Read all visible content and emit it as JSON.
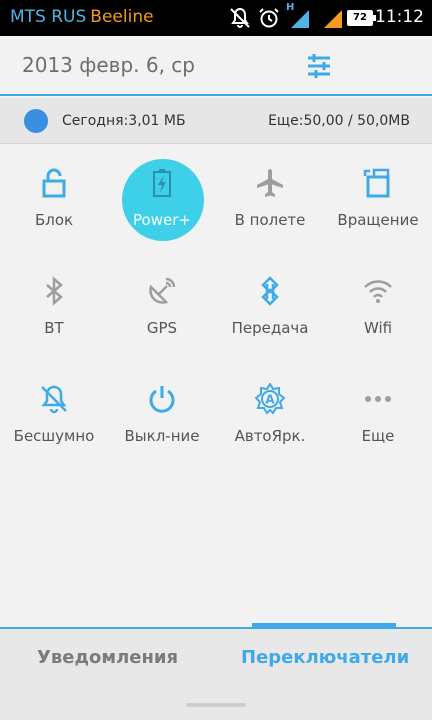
{
  "status_bar": {
    "carrier_primary": "MTS RUS",
    "carrier_secondary": "Beeline",
    "network_indicator": "H",
    "battery_level": "72",
    "time": "11:12",
    "icons": [
      "mute-icon",
      "alarm-icon",
      "signal-h-icon",
      "signal-icon",
      "battery-icon"
    ]
  },
  "header": {
    "date": "2013 февр. 6, ср",
    "settings_icon": "settings-sliders-icon"
  },
  "data_usage": {
    "today": "Сегодня:3,01 МБ",
    "remaining": "Еще:50,00 / 50,0MB"
  },
  "toggles": [
    {
      "label": "Блок",
      "icon": "lock-icon",
      "active": false
    },
    {
      "label": "Power+",
      "icon": "battery-saver-icon",
      "active": true
    },
    {
      "label": "В полете",
      "icon": "airplane-icon",
      "active": false
    },
    {
      "label": "Вращение",
      "icon": "rotation-icon",
      "active": false
    },
    {
      "label": "BT",
      "icon": "bluetooth-icon",
      "active": false
    },
    {
      "label": "GPS",
      "icon": "gps-icon",
      "active": false
    },
    {
      "label": "Передача",
      "icon": "data-transfer-icon",
      "active": false
    },
    {
      "label": "Wifi",
      "icon": "wifi-icon",
      "active": false
    },
    {
      "label": "Бесшумно",
      "icon": "silent-icon",
      "active": false
    },
    {
      "label": "Выкл-ние",
      "icon": "power-icon",
      "active": false
    },
    {
      "label": "АвтоЯрк.",
      "icon": "auto-brightness-icon",
      "active": false
    },
    {
      "label": "Еще",
      "icon": "more-icon",
      "active": false
    }
  ],
  "tabs": {
    "notifications": "Уведомления",
    "switches": "Переключатели",
    "selected": "switches"
  },
  "colors": {
    "accent": "#40a9e8",
    "active_toggle": "#3dd0e8",
    "inactive_icon": "#9e9e9e"
  }
}
